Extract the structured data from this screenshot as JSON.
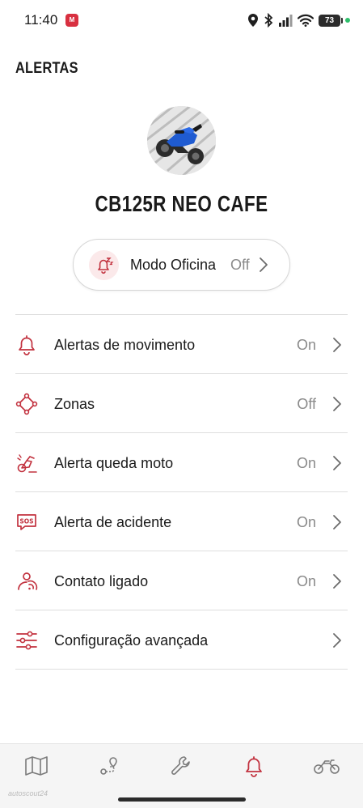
{
  "status_bar": {
    "time": "11:40",
    "app_badge": "M",
    "battery": "73",
    "icons": [
      "location-icon",
      "bluetooth-icon",
      "signal-icon",
      "wifi-icon"
    ]
  },
  "header": {
    "title": "ALERTAS"
  },
  "bike": {
    "name": "CB125R NEO CAFE"
  },
  "workshop_mode": {
    "label": "Modo Oficina",
    "value": "Off",
    "icon": "bell-sleep-icon"
  },
  "alerts": [
    {
      "label": "Alertas de movimento",
      "value": "On",
      "icon": "bell-icon"
    },
    {
      "label": "Zonas",
      "value": "Off",
      "icon": "zones-icon"
    },
    {
      "label": "Alerta queda moto",
      "value": "On",
      "icon": "fall-icon"
    },
    {
      "label": "Alerta de acidente",
      "value": "On",
      "icon": "sos-icon"
    },
    {
      "label": "Contato ligado",
      "value": "On",
      "icon": "ignition-icon"
    },
    {
      "label": "Configuração avançada",
      "value": "",
      "icon": "sliders-icon"
    }
  ],
  "nav": {
    "items": [
      "map-icon",
      "route-icon",
      "wrench-icon",
      "bell-icon",
      "motorcycle-icon"
    ],
    "active": "bell-icon"
  },
  "watermark": "autoscout24",
  "colors": {
    "accent": "#c2323f",
    "text": "#1a1a1a",
    "muted": "#8a8a8a",
    "divider": "#dedede"
  }
}
